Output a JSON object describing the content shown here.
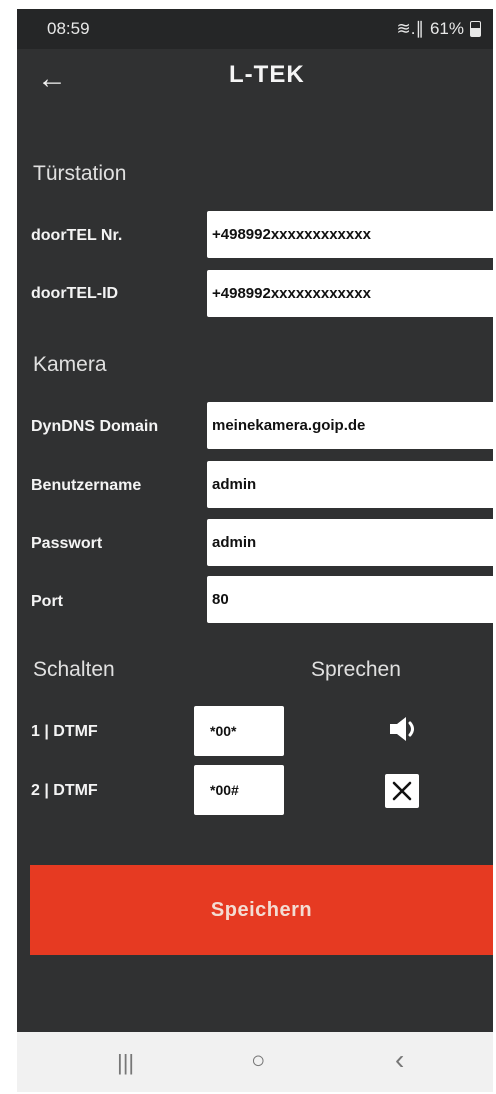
{
  "status": {
    "time": "08:59",
    "signal_icons": "≋.∥",
    "battery": "61%"
  },
  "header": {
    "logo": "L‑TEK",
    "back_icon": "arrow-left"
  },
  "door_station": {
    "title": "Türstation",
    "phone_label": "doorTEL Nr.",
    "phone_value": "+498992xxxxxxxxxxxx",
    "id_label": "doorTEL-ID",
    "id_value": "+498992xxxxxxxxxxxx"
  },
  "camera": {
    "title": "Kamera",
    "domain_label": "DynDNS Domain",
    "domain_value": "meinekamera.goip.de",
    "user_label": "Benutzername",
    "user_value": "admin",
    "password_label": "Passwort",
    "password_value": "admin",
    "port_label": "Port",
    "port_value": "80"
  },
  "switching": {
    "title": "Schalten",
    "speak_title": "Sprechen",
    "dtmf1_label": "1 | DTMF",
    "dtmf1_value": "*00*",
    "dtmf2_label": "2 | DTMF",
    "dtmf2_value": "*00#",
    "speaker_icon": "speaker",
    "close_icon": "x"
  },
  "actions": {
    "save_label": "Speichern"
  },
  "navbar": {
    "recents": "|||",
    "home": "○",
    "back": "‹"
  },
  "colors": {
    "background": "#303132",
    "accent": "#e63a22",
    "field": "#ffffff"
  }
}
